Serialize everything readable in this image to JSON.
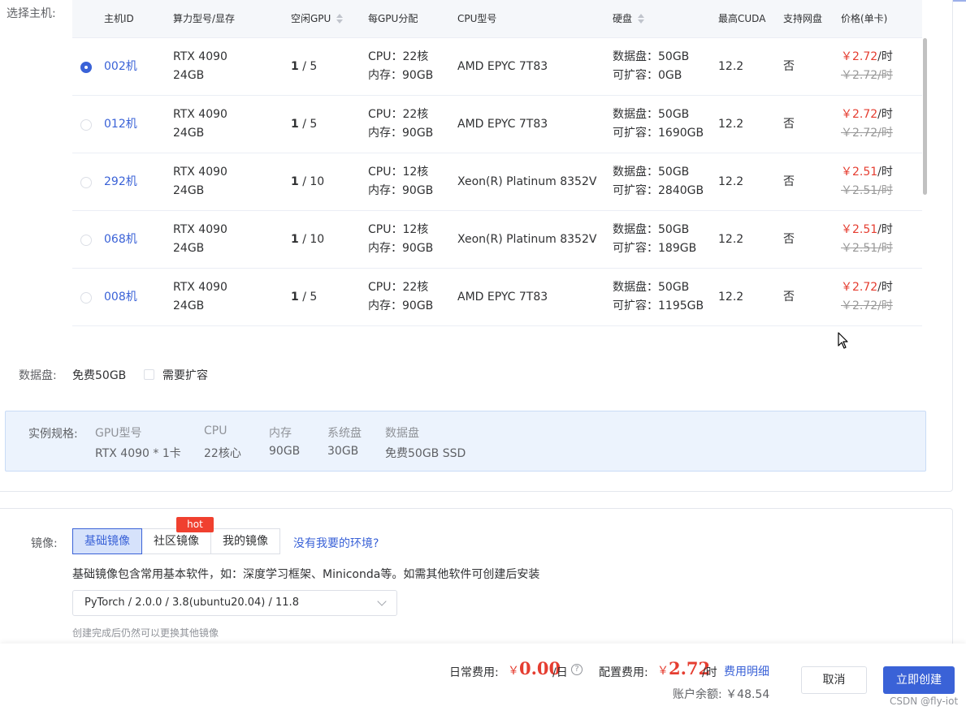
{
  "host_section": {
    "label": "选择主机:",
    "columns": {
      "host_id": "主机ID",
      "gpu_model": "算力型号/显存",
      "free_gpu": "空闲GPU",
      "per_gpu": "每GPU分配",
      "cpu_model": "CPU型号",
      "disk": "硬盘",
      "max_cuda": "最高CUDA",
      "net_disk": "支持网盘",
      "price": "价格(单卡)"
    },
    "rows": [
      {
        "selected": true,
        "id": "002机",
        "gpu": "RTX 4090",
        "vram": "24GB",
        "free": "1",
        "total": " / 5",
        "cpu": "CPU：22核",
        "mem": "内存：90GB",
        "cpu_model": "AMD EPYC 7T83",
        "disk": "数据盘：50GB",
        "expand": "可扩容：0GB",
        "cuda": "12.2",
        "net": "否",
        "price": "￥2.72",
        "unit": "/时",
        "orig_price": "￥2.72/时"
      },
      {
        "selected": false,
        "id": "012机",
        "gpu": "RTX 4090",
        "vram": "24GB",
        "free": "1",
        "total": " / 5",
        "cpu": "CPU：22核",
        "mem": "内存：90GB",
        "cpu_model": "AMD EPYC 7T83",
        "disk": "数据盘：50GB",
        "expand": "可扩容：1690GB",
        "cuda": "12.2",
        "net": "否",
        "price": "￥2.72",
        "unit": "/时",
        "orig_price": "￥2.72/时"
      },
      {
        "selected": false,
        "id": "292机",
        "gpu": "RTX 4090",
        "vram": "24GB",
        "free": "1",
        "total": " / 10",
        "cpu": "CPU：12核",
        "mem": "内存：90GB",
        "cpu_model": "Xeon(R) Platinum 8352V",
        "disk": "数据盘：50GB",
        "expand": "可扩容：2840GB",
        "cuda": "12.2",
        "net": "否",
        "price": "￥2.51",
        "unit": "/时",
        "orig_price": "￥2.51/时"
      },
      {
        "selected": false,
        "id": "068机",
        "gpu": "RTX 4090",
        "vram": "24GB",
        "free": "1",
        "total": " / 10",
        "cpu": "CPU：12核",
        "mem": "内存：90GB",
        "cpu_model": "Xeon(R) Platinum 8352V",
        "disk": "数据盘：50GB",
        "expand": "可扩容：189GB",
        "cuda": "12.2",
        "net": "否",
        "price": "￥2.51",
        "unit": "/时",
        "orig_price": "￥2.51/时"
      },
      {
        "selected": false,
        "id": "008机",
        "gpu": "RTX 4090",
        "vram": "24GB",
        "free": "1",
        "total": " / 5",
        "cpu": "CPU：22核",
        "mem": "内存：90GB",
        "cpu_model": "AMD EPYC 7T83",
        "disk": "数据盘：50GB",
        "expand": "可扩容：1195GB",
        "cuda": "12.2",
        "net": "否",
        "price": "￥2.72",
        "unit": "/时",
        "orig_price": "￥2.72/时"
      }
    ]
  },
  "data_disk": {
    "label": "数据盘:",
    "free": "免费50GB",
    "expand_label": "需要扩容",
    "expand_checked": false
  },
  "spec": {
    "title": "实例规格:",
    "items": [
      {
        "key": "GPU型号",
        "value": "RTX 4090 * 1卡"
      },
      {
        "key": "CPU",
        "value": "22核心"
      },
      {
        "key": "内存",
        "value": "90GB"
      },
      {
        "key": "系统盘",
        "value": "30GB"
      },
      {
        "key": "数据盘",
        "value": "免费50GB SSD"
      }
    ]
  },
  "image": {
    "label": "镜像:",
    "tabs": [
      "基础镜像",
      "社区镜像",
      "我的镜像"
    ],
    "active_tab": 0,
    "hot_badge": "hot",
    "missing_env_link": "没有我要的环境?",
    "description": "基础镜像包含常用基本软件，如：深度学习框架、Miniconda等。如需其他软件可创建后安装",
    "selected_image": "PyTorch / 2.0.0 / 3.8(ubuntu20.04) / 11.8",
    "tip": "创建完成后仍然可以更换其他镜像"
  },
  "footer": {
    "daily_label": "日常费用:",
    "daily_currency": "￥",
    "daily_amount": "0.00",
    "daily_unit": "/日",
    "config_label": "配置费用:",
    "config_currency": "￥",
    "config_amount": "2.72",
    "config_unit": "/时",
    "detail_link": "费用明细",
    "balance": "账户余额: ￥48.54",
    "cancel_button": "取消",
    "create_button": "立即创建",
    "watermark": "CSDN @fly-iot"
  },
  "colors": {
    "primary": "#3a62d7",
    "price_red": "#e53d30",
    "hot_badge": "#f0402f",
    "spec_bg": "#ecf3fd"
  }
}
